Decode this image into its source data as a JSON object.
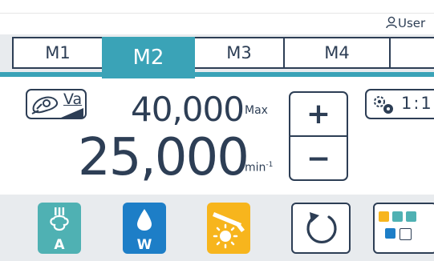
{
  "header": {
    "user_label": "User"
  },
  "tabs": [
    {
      "label": "M1",
      "active": false
    },
    {
      "label": "M2",
      "active": true
    },
    {
      "label": "M3",
      "active": false
    },
    {
      "label": "M4",
      "active": false
    }
  ],
  "motor": {
    "mode_label": "Va",
    "max_speed": "40,000",
    "max_unit": "Max",
    "current_speed": "25,000",
    "current_unit": "min",
    "current_unit_exp": "-1",
    "increase_label": "+",
    "decrease_label": "−",
    "gear_ratio": "1:1"
  },
  "bottom": {
    "air_label": "A",
    "water_label": "W"
  },
  "colors": {
    "accent": "#3aa3b7",
    "text": "#2d3e55",
    "air": "#4fb1b3",
    "water": "#1d7ec7",
    "light": "#f7b51d",
    "bar_bg": "#e8ebee"
  },
  "icons": [
    "user-icon",
    "handpiece-icon",
    "ramp-icon",
    "gears-icon",
    "air-icon",
    "water-drop-icon",
    "light-icon",
    "rotation-icon",
    "settings-grid-icon"
  ]
}
